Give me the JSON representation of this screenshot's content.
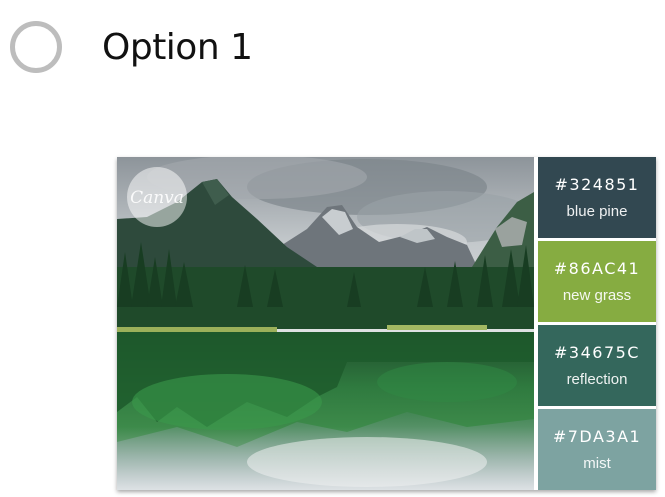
{
  "option": {
    "label": "Option 1"
  },
  "watermark": {
    "text": "Canva"
  },
  "palette": [
    {
      "hex": "#324851",
      "name": "blue pine",
      "color": "#324851"
    },
    {
      "hex": "#86AC41",
      "name": "new grass",
      "color": "#86AC41"
    },
    {
      "hex": "#34675C",
      "name": "reflection",
      "color": "#34675C"
    },
    {
      "hex": "#7DA3A1",
      "name": "mist",
      "color": "#7DA3A1"
    }
  ]
}
